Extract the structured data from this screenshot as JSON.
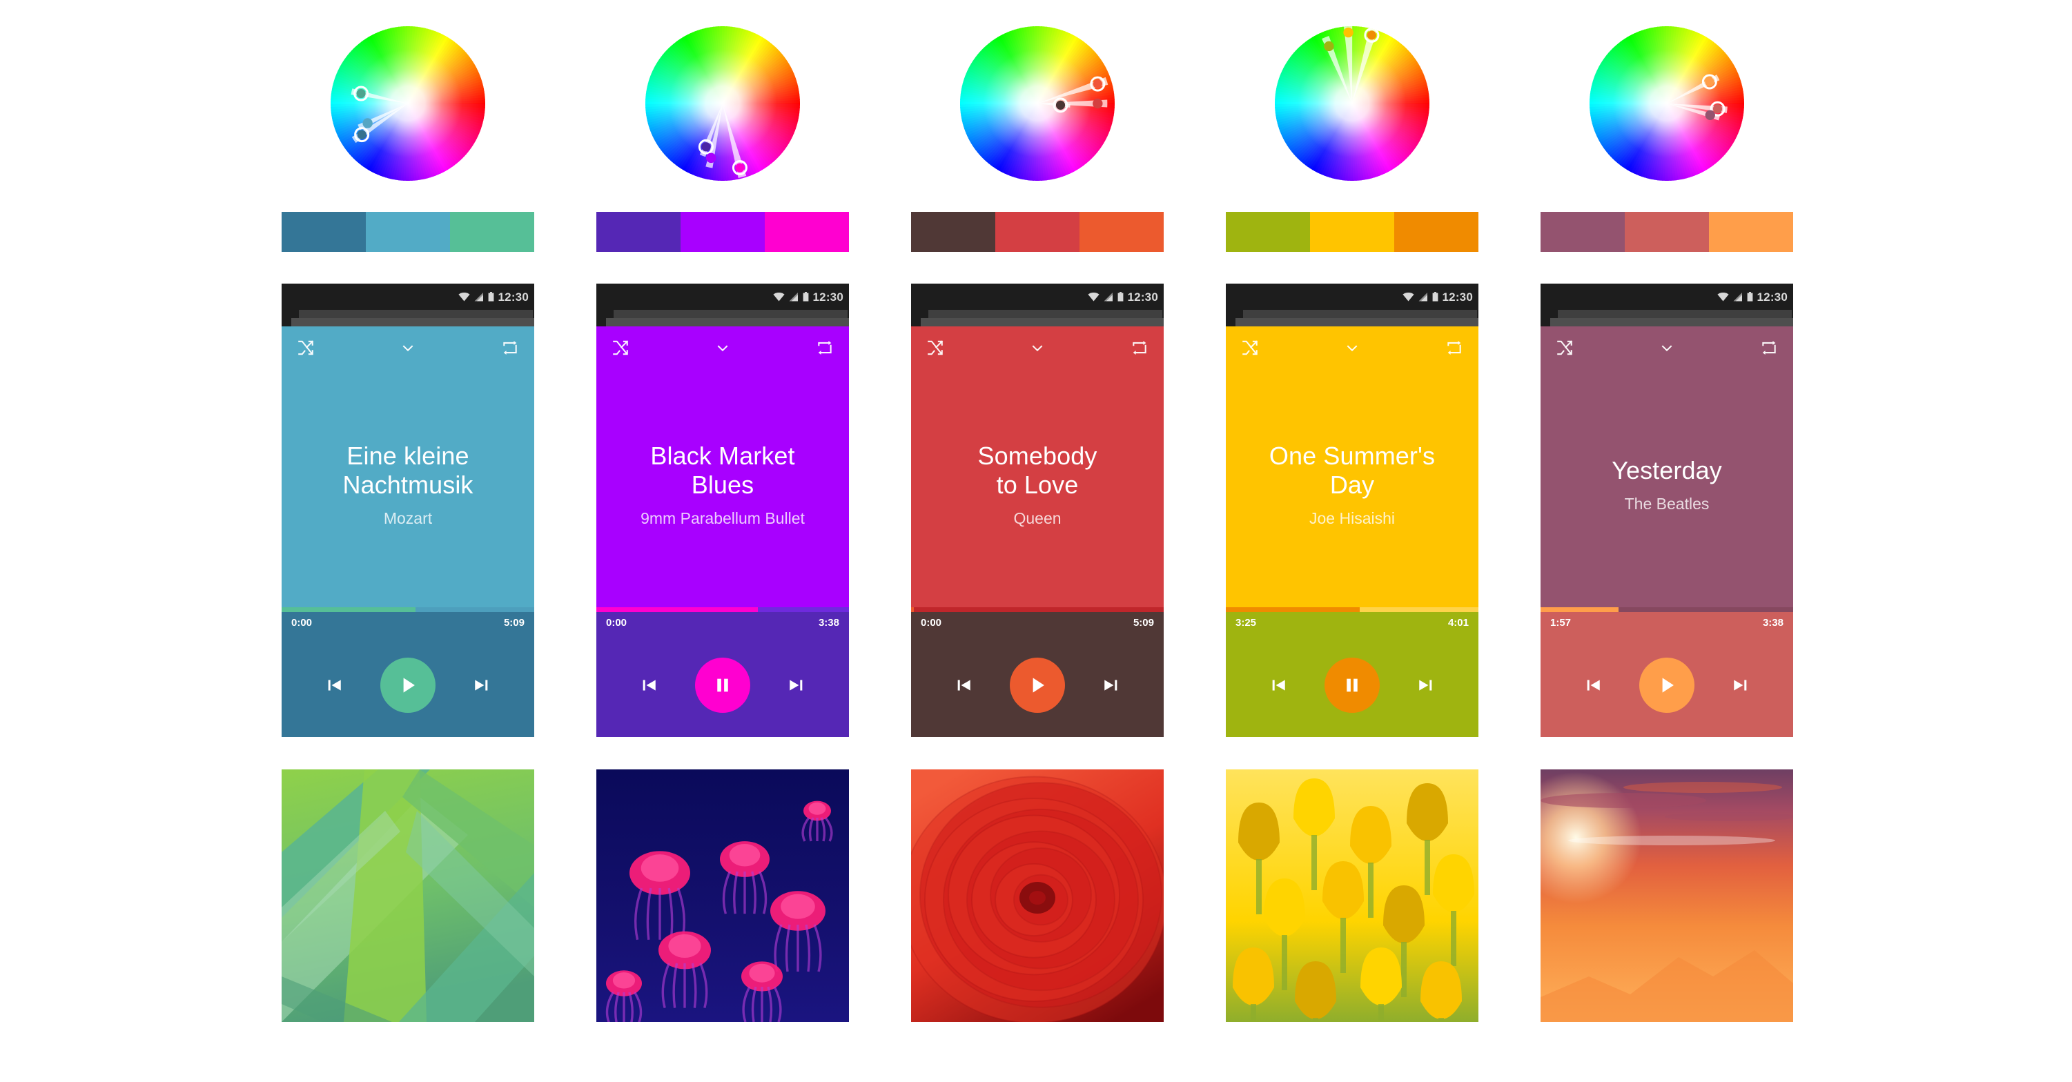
{
  "page": {
    "title": "Material Design color palette and music player mockups",
    "background": "#ffffff",
    "columns": 5
  },
  "status_bar": {
    "clock": "12:30",
    "icons": [
      "wifi-icon",
      "signal-icon",
      "battery-icon"
    ],
    "background": "#1d1d1d",
    "text_color": "#d8d8d8"
  },
  "player_icons": {
    "shuffle": "shuffle-icon",
    "collapse": "chevron-down-icon",
    "repeat": "repeat-icon"
  },
  "transport_labels": {
    "previous": "previous-track",
    "next": "next-track",
    "play": "play",
    "pause": "pause"
  },
  "columns": [
    {
      "id": "column-1",
      "wheel": {
        "name": "color-wheel-analogous-blue",
        "markers": [
          {
            "color": "#4ea48e",
            "angle": 168,
            "radius": 0.62,
            "ring": true,
            "wedge": true
          },
          {
            "color": "#55a6c4",
            "angle": 206,
            "radius": 0.58,
            "ring": false,
            "wedge": true
          },
          {
            "color": "#35718f",
            "angle": 214,
            "radius": 0.72,
            "ring": true,
            "wedge": true
          }
        ]
      },
      "palette": [
        "#347697",
        "#52abc6",
        "#56bf97"
      ],
      "phone": {
        "title": "Eine kleine\nNachtmusik",
        "artist": "Mozart",
        "time_elapsed": "0:00",
        "time_total": "5:09",
        "progress_percent": 53,
        "playing": false,
        "colors": {
          "primary": "#52abc6",
          "bottom": "#347697",
          "accent": "#56bf97",
          "progress_track": "#4d9fbd",
          "fab_icon": "#ffffff"
        }
      },
      "photo": {
        "name": "photo-green-leaves",
        "alt": "Close-up of overlapping green leaves",
        "palette": [
          "#8fd14a",
          "#6fc06a",
          "#5bb68e",
          "#7fc9a2",
          "#a9dcb6",
          "#4f9e78"
        ]
      }
    },
    {
      "id": "column-2",
      "wheel": {
        "name": "color-wheel-analogous-violet",
        "markers": [
          {
            "color": "#4b25a6",
            "angle": 249,
            "radius": 0.6,
            "ring": true,
            "wedge": true
          },
          {
            "color": "#a800ff",
            "angle": 258,
            "radius": 0.72,
            "ring": false,
            "wedge": true
          },
          {
            "color": "#ff00d0",
            "angle": 285,
            "radius": 0.86,
            "ring": true,
            "wedge": true
          }
        ]
      },
      "palette": [
        "#5527b5",
        "#a800ff",
        "#ff00d0"
      ],
      "phone": {
        "title": "Black Market\nBlues",
        "artist": "9mm Parabellum Bullet",
        "time_elapsed": "0:00",
        "time_total": "3:38",
        "progress_percent": 64,
        "playing": true,
        "colors": {
          "primary": "#a800ff",
          "bottom": "#5527b5",
          "accent": "#ff00d0",
          "progress_track": "#6f2ade",
          "fab_icon": "#ffffff"
        }
      },
      "photo": {
        "name": "photo-pink-jellyfish",
        "alt": "Pink jellyfish glowing on a deep blue background",
        "palette": [
          "#0a0a5a",
          "#14106e",
          "#ff1e7a",
          "#ff4f9c",
          "#b33bd4",
          "#1a1480"
        ]
      }
    },
    {
      "id": "column-3",
      "wheel": {
        "name": "color-wheel-analogous-red",
        "markers": [
          {
            "color": "#f0563a",
            "angle": 18,
            "radius": 0.82,
            "ring": true,
            "wedge": true
          },
          {
            "color": "#d43f3f",
            "angle": 0,
            "radius": 0.78,
            "ring": false,
            "wedge": true
          },
          {
            "color": "#4c3533",
            "angle": 356,
            "radius": 0.3,
            "ring": true,
            "wedge": true
          }
        ]
      },
      "palette": [
        "#503836",
        "#d43f43",
        "#ec5a2e"
      ],
      "phone": {
        "title": "Somebody\nto Love",
        "artist": "Queen",
        "time_elapsed": "0:00",
        "time_total": "5:09",
        "progress_percent": 1,
        "playing": false,
        "colors": {
          "primary": "#d43f43",
          "bottom": "#503836",
          "accent": "#ec5a2e",
          "progress_track": "#c0262b",
          "fab_icon": "#ffffff"
        }
      },
      "photo": {
        "name": "photo-red-rose",
        "alt": "Macro photo of a red ranunculus flower",
        "palette": [
          "#cf1a1a",
          "#e03022",
          "#a50f12",
          "#f25a3a",
          "#7d0a0c",
          "#e84a30"
        ]
      }
    },
    {
      "id": "column-4",
      "wheel": {
        "name": "color-wheel-analogous-yellow",
        "markers": [
          {
            "color": "#9fb410",
            "angle": 112,
            "radius": 0.8,
            "ring": false,
            "wedge": true
          },
          {
            "color": "#ffc100",
            "angle": 93,
            "radius": 0.92,
            "ring": false,
            "wedge": true
          },
          {
            "color": "#ef8c05",
            "angle": 74,
            "radius": 0.92,
            "ring": true,
            "wedge": true
          }
        ]
      },
      "palette": [
        "#9fb410",
        "#ffc400",
        "#f08b00"
      ],
      "phone": {
        "title": "One Summer's\nDay",
        "artist": "Joe Hisaishi",
        "time_elapsed": "3:25",
        "time_total": "4:01",
        "progress_percent": 53,
        "playing": true,
        "colors": {
          "primary": "#ffc400",
          "bottom": "#9fb410",
          "accent": "#f08b00",
          "progress_track": "#ffd34a",
          "fab_icon": "#ffffff"
        }
      },
      "photo": {
        "name": "photo-yellow-tulips",
        "alt": "Field of yellow tulips",
        "palette": [
          "#ffd400",
          "#f9c200",
          "#d9a800",
          "#8fae2c",
          "#ffe35c",
          "#c49c00"
        ]
      }
    },
    {
      "id": "column-5",
      "wheel": {
        "name": "color-wheel-analogous-warm-rose",
        "markers": [
          {
            "color": "#ff9e4a",
            "angle": 27,
            "radius": 0.62,
            "ring": true,
            "wedge": true
          },
          {
            "color": "#cd5f5c",
            "angle": 354,
            "radius": 0.66,
            "ring": true,
            "wedge": true
          },
          {
            "color": "#94536f",
            "angle": 345,
            "radius": 0.58,
            "ring": false,
            "wedge": true
          }
        ]
      },
      "palette": [
        "#94536f",
        "#cd5f5c",
        "#ff9e4a"
      ],
      "phone": {
        "title": "Yesterday",
        "artist": "The Beatles",
        "time_elapsed": "1:57",
        "time_total": "3:38",
        "progress_percent": 31,
        "playing": false,
        "colors": {
          "primary": "#94536f",
          "bottom": "#cd5f5c",
          "accent": "#ff9e4a",
          "progress_track": "#86485f",
          "fab_icon": "#ffffff"
        }
      },
      "photo": {
        "name": "photo-orange-sunset",
        "alt": "Orange sunset over mountain silhouettes",
        "palette": [
          "#ffb05a",
          "#f58b3c",
          "#e2603f",
          "#a34a63",
          "#6e3f63",
          "#ffd49a"
        ]
      }
    }
  ]
}
